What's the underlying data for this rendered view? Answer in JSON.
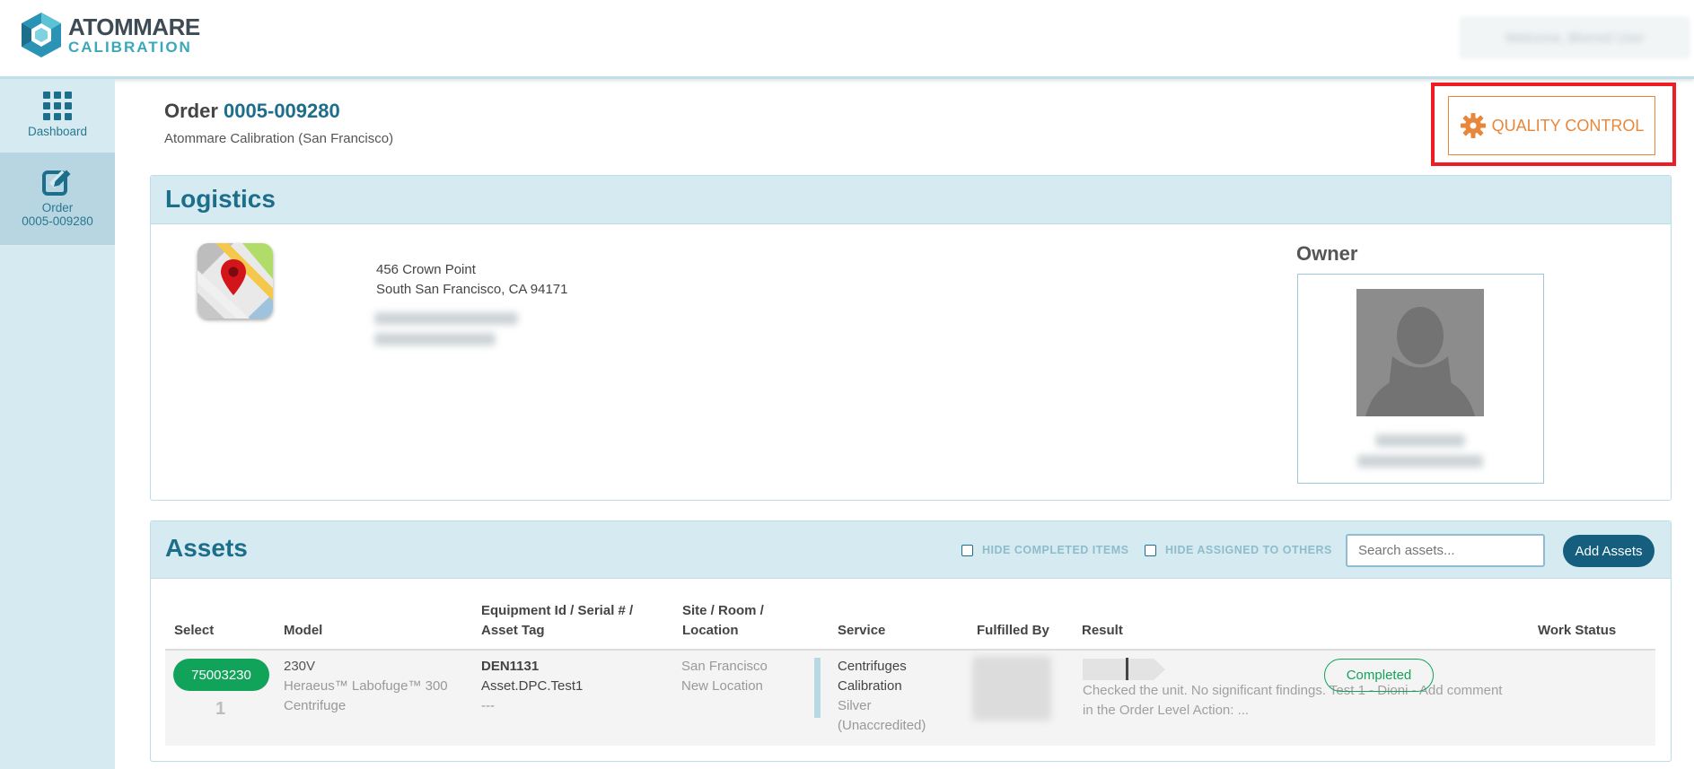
{
  "brand": {
    "line1": "ATOMMARE",
    "line2": "CALIBRATION"
  },
  "header": {
    "user_label": "Welcome, Blurred User"
  },
  "sidebar": {
    "items": [
      {
        "label": "Dashboard",
        "icon": "grid-icon"
      },
      {
        "label": "Order",
        "sublabel": "0005-009280",
        "icon": "edit-icon"
      }
    ]
  },
  "order": {
    "prefix": "Order",
    "number": "0005-009280",
    "subtitle": "Atommare Calibration (San Francisco)"
  },
  "quality_control": {
    "label": "QUALITY CONTROL",
    "icon": "gear-icon",
    "color": "#e8873a",
    "highlight_color": "#ee1c24"
  },
  "logistics": {
    "title": "Logistics",
    "address_line1": "456 Crown Point",
    "address_line2": "South San Francisco, CA 94171",
    "owner_title": "Owner"
  },
  "assets": {
    "title": "Assets",
    "hide_completed": "HIDE COMPLETED ITEMS",
    "hide_assigned": "HIDE ASSIGNED TO OTHERS",
    "search_placeholder": "Search assets...",
    "add_button": "Add Assets",
    "columns": {
      "select": "Select",
      "model": "Model",
      "equip_l1": "Equipment Id / Serial # /",
      "equip_l2": "Asset Tag",
      "site_l1": "Site / Room /",
      "site_l2": "Location",
      "service": "Service",
      "fulfilled": "Fulfilled By",
      "result": "Result",
      "status": "Work Status"
    },
    "rows": [
      {
        "select_id": "75003230",
        "index": "1",
        "model_voltage": "230V",
        "model_name_l1": "Heraeus™ Labofuge™ 300",
        "model_name_l2": "Centrifuge",
        "equipment_id": "DEN1131",
        "asset_tag": "Asset.DPC.Test1",
        "serial": "---",
        "site": "San Francisco",
        "location": "New Location",
        "service_l1": "Centrifuges",
        "service_l2": "Calibration",
        "service_l3": "Silver",
        "service_l4": "(Unaccredited)",
        "result_l1": "Checked the unit. No significant findings. Test 1 - Dioni - Add comment",
        "result_l2": "in the Order Level Action: ...",
        "work_status": "Completed"
      }
    ]
  },
  "colors": {
    "primary": "#1c6e8a",
    "success": "#12a35a",
    "panel_header": "#d5eaf1"
  }
}
